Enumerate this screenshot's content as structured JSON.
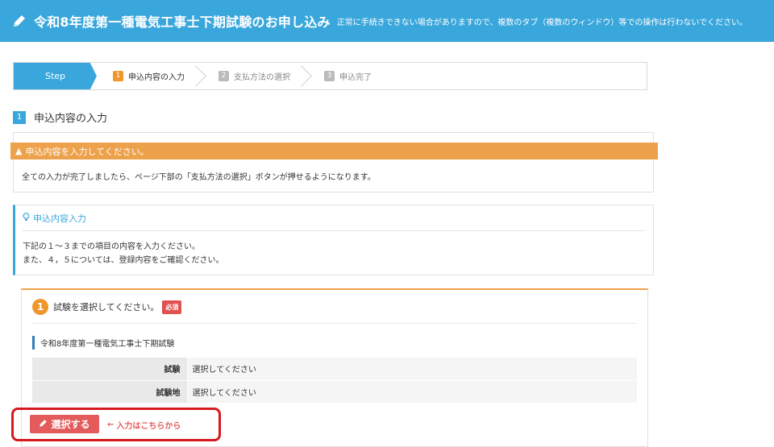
{
  "header": {
    "icon": "pencil-icon",
    "title": "令和8年度第一種電気工事士下期試験のお申し込み",
    "note": "正常に手続きできない場合がありますので、複数のタブ（複数のウィンドウ）等での操作は行わないでください。"
  },
  "steps": {
    "label": "Step",
    "items": [
      {
        "num": "1",
        "label": "申込内容の入力",
        "state": "active"
      },
      {
        "num": "2",
        "label": "支払方法の選択",
        "state": "inactive"
      },
      {
        "num": "3",
        "label": "申込完了",
        "state": "inactive"
      }
    ]
  },
  "section": {
    "num": "1",
    "title": "申込内容の入力"
  },
  "warning": {
    "icon": "warning-icon",
    "title": "申込内容を入力してください。",
    "text": "全ての入力が完了しましたら、ページ下部の「支払方法の選択」ボタンが押せるようになります。"
  },
  "info": {
    "icon": "lightbulb-icon",
    "title": "申込内容入力",
    "line1": "下記の１～３までの項目の内容を入力ください。",
    "line2": "また、４，５については、登録内容をご確認ください。"
  },
  "exam": {
    "num": "1",
    "heading": "試験を選択してください。",
    "required": "必須",
    "name": "令和8年度第一種電気工事士下期試験",
    "rows": [
      {
        "label": "試験",
        "value": "選択してください"
      },
      {
        "label": "試験地",
        "value": "選択してください"
      }
    ],
    "select_button": "選択する",
    "link_text": "入力はこちらから"
  },
  "colors": {
    "header": "#3aa7dc",
    "warning": "#eda14a",
    "accent_orange": "#f0962b",
    "button_red": "#e35b5b",
    "highlight": "#d4191f"
  }
}
